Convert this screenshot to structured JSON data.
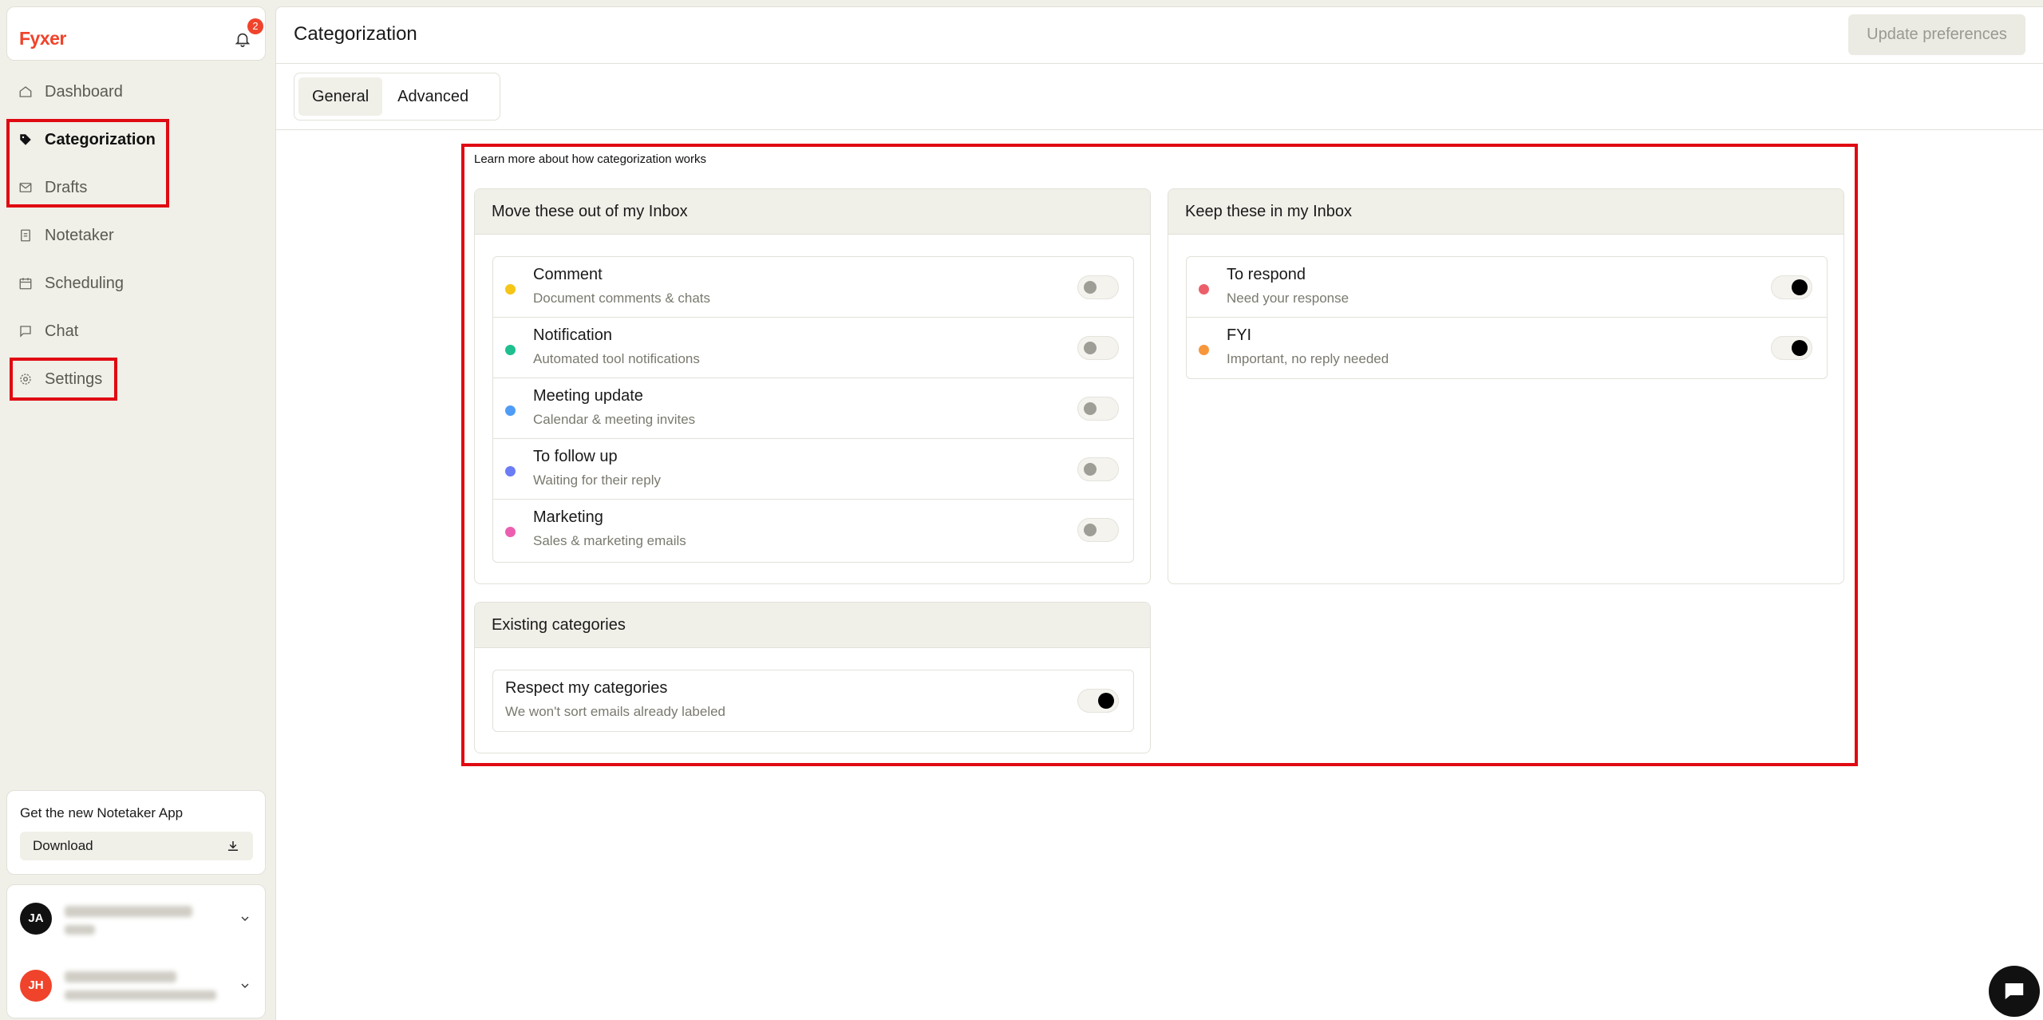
{
  "brand": {
    "name": "Fyxer",
    "notification_count": "2"
  },
  "sidebar": {
    "items": [
      {
        "label": "Dashboard",
        "icon": "home-icon"
      },
      {
        "label": "Categorization",
        "icon": "tag-icon",
        "active": true
      },
      {
        "label": "Drafts",
        "icon": "mail-icon"
      },
      {
        "label": "Notetaker",
        "icon": "notepad-icon"
      },
      {
        "label": "Scheduling",
        "icon": "calendar-icon"
      },
      {
        "label": "Chat",
        "icon": "chat-icon"
      },
      {
        "label": "Settings",
        "icon": "gear-icon"
      }
    ],
    "app_promo": {
      "title": "Get the new Notetaker App",
      "button": "Download"
    },
    "accounts": [
      {
        "initials": "JA",
        "color": "#111111"
      },
      {
        "initials": "JH",
        "color": "#f0432b"
      }
    ]
  },
  "header": {
    "title": "Categorization",
    "update_button": "Update preferences"
  },
  "tabs": [
    {
      "label": "General",
      "active": true
    },
    {
      "label": "Advanced",
      "active": false
    }
  ],
  "content": {
    "learn_link": "Learn more about how categorization works",
    "move_out": {
      "title": "Move these out of my Inbox",
      "items": [
        {
          "title": "Comment",
          "subtitle": "Document comments & chats",
          "color": "#f5c518",
          "enabled": false
        },
        {
          "title": "Notification",
          "subtitle": "Automated tool notifications",
          "color": "#1fbf8f",
          "enabled": false
        },
        {
          "title": "Meeting update",
          "subtitle": "Calendar & meeting invites",
          "color": "#4f9cf7",
          "enabled": false
        },
        {
          "title": "To follow up",
          "subtitle": "Waiting for their reply",
          "color": "#6b7cf5",
          "enabled": false
        },
        {
          "title": "Marketing",
          "subtitle": "Sales & marketing emails",
          "color": "#ec5fb0",
          "enabled": false
        }
      ]
    },
    "keep_in": {
      "title": "Keep these in my Inbox",
      "items": [
        {
          "title": "To respond",
          "subtitle": "Need your response",
          "color": "#ec5f6a",
          "enabled": true
        },
        {
          "title": "FYI",
          "subtitle": "Important, no reply needed",
          "color": "#f7963b",
          "enabled": true
        }
      ]
    },
    "existing": {
      "title": "Existing categories",
      "item": {
        "title": "Respect my categories",
        "subtitle": "We won't sort emails already labeled",
        "enabled": true
      }
    }
  },
  "colors": {
    "accent": "#f0432b",
    "highlight": "#e00a12",
    "sidebar_bg": "#f0efe8"
  }
}
